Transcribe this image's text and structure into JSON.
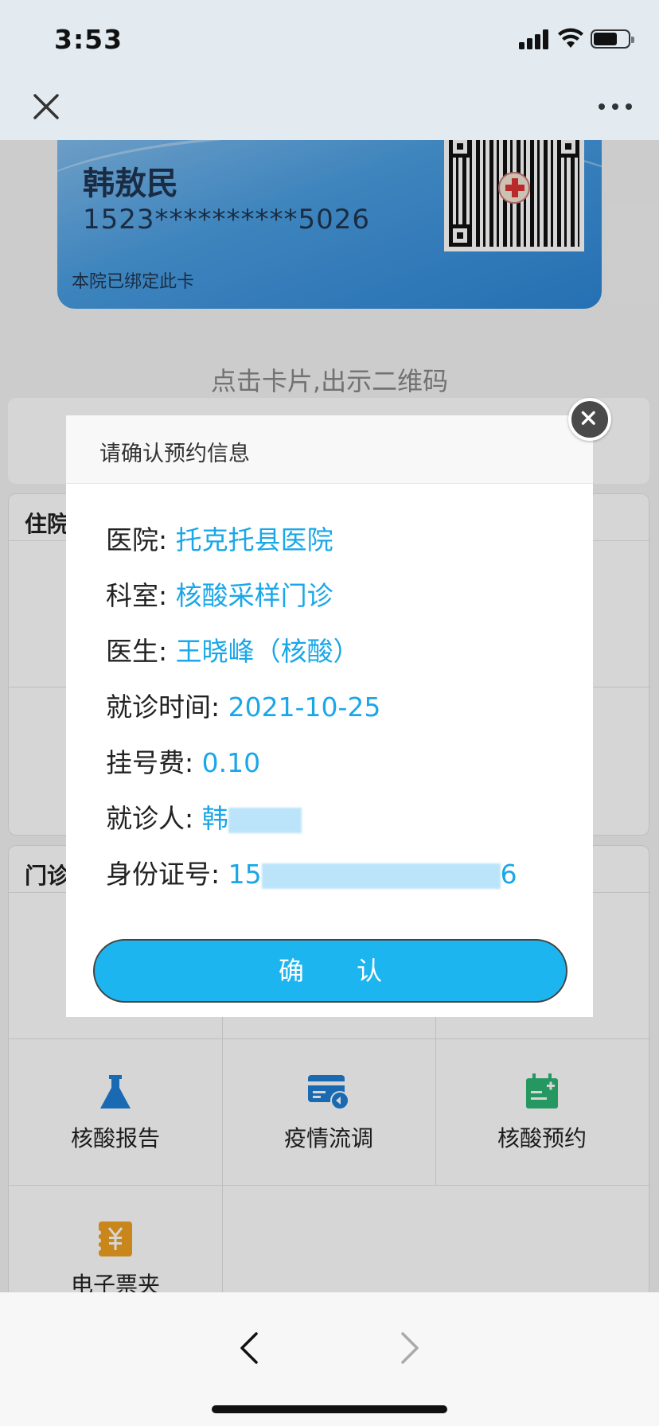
{
  "status_bar": {
    "time": "3:53"
  },
  "card": {
    "name": "韩敖民",
    "number": "1523**********5026",
    "note": "本院已绑定此卡"
  },
  "hint": "点击卡片,出示二维码",
  "sections": {
    "inpatient_title": "住院",
    "outpatient_title": "门诊"
  },
  "tiles": [
    {
      "label": "核酸报告",
      "icon": "flask-icon",
      "color": "#1e7fd6"
    },
    {
      "label": "疫情流调",
      "icon": "card-icon",
      "color": "#1e7fd6"
    },
    {
      "label": "核酸预约",
      "icon": "calendar-add-icon",
      "color": "#2bb673"
    },
    {
      "label": "电子票夹",
      "icon": "yuan-ticket-icon",
      "color": "#f0a020"
    }
  ],
  "modal": {
    "title": "请确认预约信息",
    "rows": [
      {
        "label": "医院: ",
        "value": "托克托县医院"
      },
      {
        "label": "科室: ",
        "value": "核酸采样门诊"
      },
      {
        "label": "医生: ",
        "value": "王晓峰（核酸）"
      },
      {
        "label": "就诊时间: ",
        "value": "2021-10-25"
      },
      {
        "label": "挂号费: ",
        "value": "0.10"
      },
      {
        "label": "就诊人: ",
        "value": "韩"
      },
      {
        "label": "身份证号: ",
        "value": "15",
        "value_tail": "6"
      }
    ],
    "confirm": "确 认"
  },
  "colors": {
    "accent": "#1db5f0",
    "value_text": "#1aa7e8"
  }
}
